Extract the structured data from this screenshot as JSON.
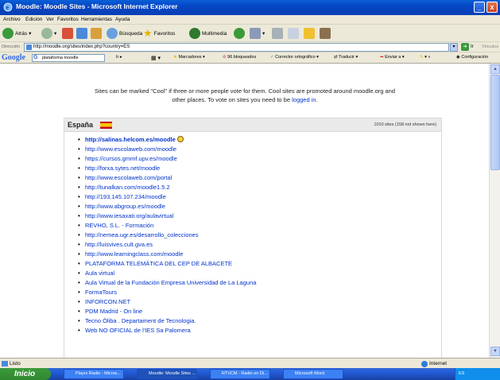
{
  "window": {
    "title": "Moodle: Moodle Sites - Microsoft Internet Explorer",
    "minimize": "_",
    "close": "x"
  },
  "menu": [
    "Archivo",
    "Edición",
    "Ver",
    "Favoritos",
    "Herramientas",
    "Ayuda"
  ],
  "toolbar": {
    "back": "Atrás",
    "search": "Búsqueda",
    "favorites": "Favoritos",
    "multimedia": "Multimedia"
  },
  "address": {
    "label": "Dirección",
    "url": "http://moodle.org/sites/index.php?country=ES",
    "go": "Ir",
    "links": "Vínculos"
  },
  "google": {
    "logo": "Google",
    "query": "plataforma moodle",
    "go": "Ir",
    "bookmarks": "Marcadores",
    "blocked": "96 bloqueados",
    "spell": "Corrector ortográfico",
    "translate": "Traducir",
    "send": "Enviar a",
    "settings": "Configuración"
  },
  "page": {
    "intro_text": "Sites can be marked \"Cool\" if three or more people vote for them. Cool sites are promoted around moodle.org and other places. To vote on sites you need to be",
    "login_link": "logged in",
    "country": "España",
    "site_count": "1010 sites (158 not shown here)",
    "sites": [
      "http://salinas.helcom.es/moodle",
      "http://www.escolaweb.com/moodle",
      "https://cursos.gmmf.upv.es/moodle",
      "http://forxa.sytes.net/moodle",
      "http://www.escolaweb.com/portal",
      "http://tunalkan.com/moodle1.5.2",
      "http://193.145.107.234/moodle",
      "http://www.abgroup.es/moodle",
      "http://www.iesaxati.org/aulavirtual",
      "REVHO, S.L. - Formación",
      "http://nemea.ugr.es/desarrollo_colecciones",
      "http://luisvives.cult.gva.es",
      "http://www.learningclass.com/moodle",
      "PLATAFORMA TELEMÁTICA DEL CEP DE ALBACETE",
      "Aula virtual",
      "Aula Virtual de la Fundación Empresa Universidad de La Laguna",
      "FormaTours",
      "INFORCON.NET",
      "PDM Madrid - On line",
      "Tecno Òliba . Departament de Tecnologia.",
      "Web NO OFICIAL de l'IES Sa Palomera"
    ]
  },
  "status": {
    "text": "Listo",
    "zone": "Internet"
  },
  "taskbar": {
    "start": "Inicio",
    "tasks": [
      "Playrs Radio - Micros...",
      "Moodle: Moodle Sites ...",
      "RTVCM - Radio en Di...",
      "Microsoft Word"
    ],
    "tray": "ES"
  }
}
